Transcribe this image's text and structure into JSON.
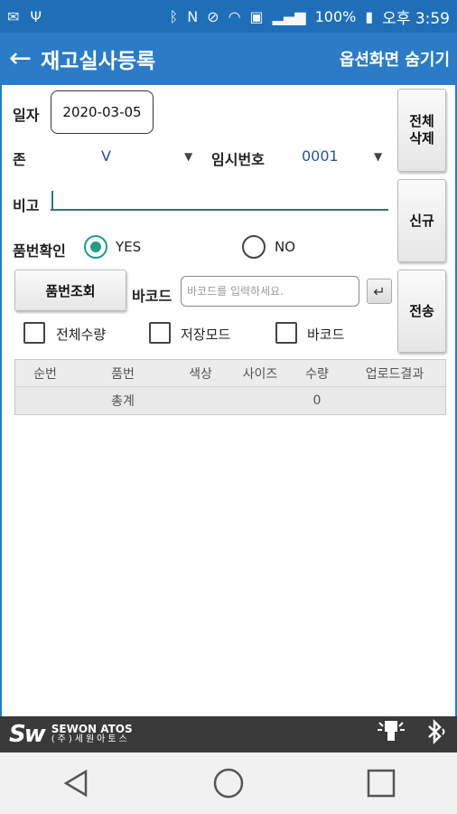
{
  "status_bar": {
    "battery": "100%",
    "clock": "오후 3:59"
  },
  "header": {
    "title": "재고실사등록",
    "hide_options_label": "옵션화면 숨기기"
  },
  "form": {
    "date_label": "일자",
    "date_value": "2020-03-05",
    "zone_label": "존",
    "zone_value": "V",
    "temp_no_label": "임시번호",
    "temp_no_value": "0001",
    "memo_label": "비고",
    "memo_value": "",
    "item_check_label": "품번확인",
    "radio_yes": "YES",
    "radio_no": "NO",
    "radio_selected": "YES",
    "lookup_button": "품번조회",
    "barcode_label": "바코드",
    "barcode_placeholder": "바코드를 입력하세요.",
    "checkbox_total_qty": "전체수량",
    "checkbox_save_mode": "저장모드",
    "checkbox_barcode": "바코드"
  },
  "side_buttons": {
    "delete_all": "전체\n삭제",
    "new": "신규",
    "send": "전송"
  },
  "table": {
    "columns": [
      "순번",
      "품번",
      "색상",
      "사이즈",
      "수량",
      "업로드결과"
    ],
    "total_label": "총계",
    "total_qty": "0"
  },
  "footer": {
    "brand_en": "SEWON ATOS",
    "brand_ko": "(주)세원아토스",
    "logo_mark": "Sw"
  }
}
